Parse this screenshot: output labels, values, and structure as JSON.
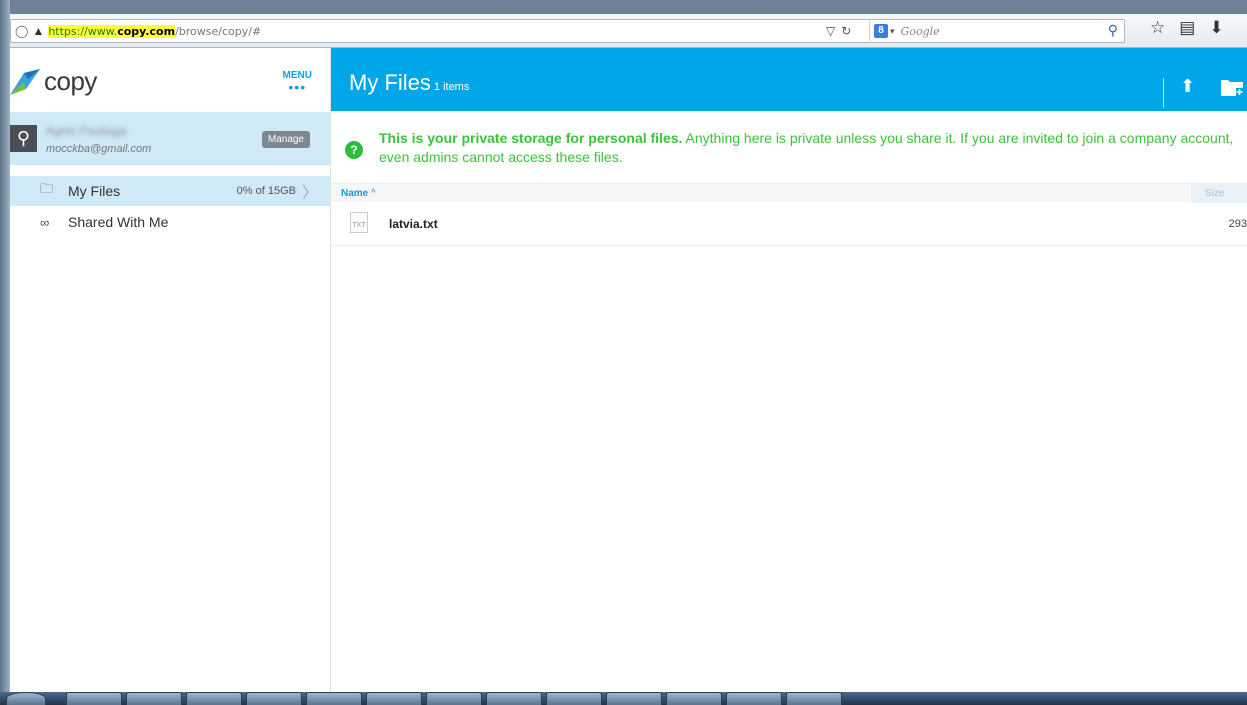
{
  "browser": {
    "url_highlight_prefix": "https://www.",
    "url_domain": "copy.com",
    "url_path": "/browse/copy/#",
    "search_placeholder": "Google",
    "search_engine_icon": "google-icon"
  },
  "sidebar": {
    "logo_text": "copy",
    "menu_label": "MENU",
    "menu_dots": "•••",
    "account": {
      "name": "Agnis Pooliaga",
      "email": "mocckba@gmail.com",
      "manage_label": "Manage"
    },
    "nav": [
      {
        "label": "My Files",
        "quota": "0% of 15GB",
        "icon": "folder-icon"
      },
      {
        "label": "Shared With Me",
        "icon": "shared-users-icon"
      }
    ]
  },
  "main": {
    "title": "My Files",
    "item_count": "1 items",
    "notice_bold": "This is your private storage for personal files.",
    "notice_text": " Anything here is private unless you share it. If you are invited to join a company account, even admins cannot access these files.",
    "columns": {
      "name": "Name",
      "size": "Size"
    },
    "sort_indicator": "^",
    "files": [
      {
        "name": "latvia.txt",
        "size": "293",
        "type_label": "TXT"
      }
    ]
  },
  "colors": {
    "brand_blue": "#00a7e8",
    "notice_green": "#3cc23c",
    "selected_bg": "#cfe9f7"
  }
}
